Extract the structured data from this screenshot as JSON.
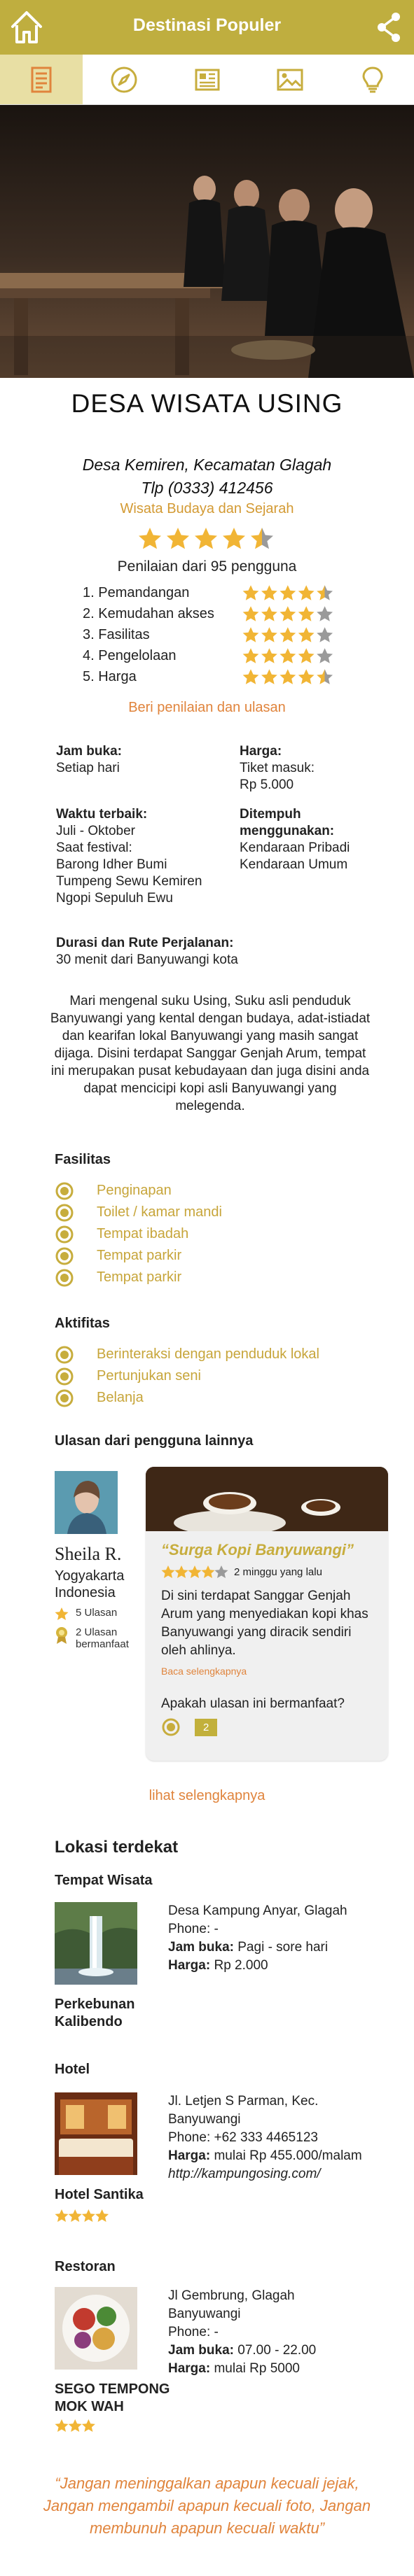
{
  "header": {
    "title": "Destinasi Populer",
    "home_icon": "home-icon",
    "share_icon": "share-icon",
    "color": "#bfae3f"
  },
  "tabs": [
    {
      "icon": "document-icon",
      "active": true
    },
    {
      "icon": "compass-icon",
      "active": false
    },
    {
      "icon": "newspaper-icon",
      "active": false
    },
    {
      "icon": "image-icon",
      "active": false
    },
    {
      "icon": "lightbulb-icon",
      "active": false
    }
  ],
  "destination": {
    "name": "DESA WISATA USING",
    "address_line1": "Desa Kemiren, Kecamatan Glagah",
    "address_line2": "Tlp (0333) 412456",
    "category": "Wisata Budaya dan Sejarah",
    "rating": 4.5,
    "rating_text": "Penilaian dari 95 pengguna",
    "criteria": [
      {
        "label": "1. Pemandangan",
        "rating": 4.5
      },
      {
        "label": "2. Kemudahan akses",
        "rating": 4
      },
      {
        "label": "3. Fasilitas",
        "rating": 4
      },
      {
        "label": "4. Pengelolaan",
        "rating": 4
      },
      {
        "label": "5. Harga",
        "rating": 4.5
      }
    ],
    "rate_link": "Beri penilaian dan ulasan"
  },
  "info": {
    "open_label": "Jam buka:",
    "open_value": "Setiap hari",
    "price_label": "Harga:",
    "price_line1": "Tiket masuk:",
    "price_line2": "Rp 5.000",
    "best_time_label": "Waktu terbaik:",
    "best_time_line1": "Juli - Oktober",
    "best_time_line2": "Saat festival:",
    "best_time_line3": "Barong Idher Bumi",
    "best_time_line4": "Tumpeng Sewu Kemiren",
    "best_time_line5": "Ngopi Sepuluh Ewu",
    "reach_label_line1": "Ditempuh",
    "reach_label_line2": "menggunakan:",
    "reach_line1": "Kendaraan Pribadi",
    "reach_line2": "Kendaraan Umum",
    "route_label": "Durasi dan Rute Perjalanan:",
    "route_value": "30 menit dari Banyuwangi kota"
  },
  "description": "Mari mengenal suku Using, Suku asli penduduk Banyuwangi yang kental dengan budaya, adat-istiadat dan kearifan lokal Banyuwangi yang masih sangat dijaga. Disini terdapat Sanggar Genjah Arum, tempat ini merupakan pusat kebudayaan dan juga disini anda dapat mencicipi kopi asli Banyuwangi yang melegenda.",
  "facilities": {
    "heading": "Fasilitas",
    "items": [
      "Penginapan",
      "Toilet / kamar mandi",
      "Tempat ibadah",
      "Tempat parkir",
      "Tempat parkir"
    ]
  },
  "activities": {
    "heading": "Aktifitas",
    "items": [
      "Berinteraksi dengan penduduk lokal",
      "Pertunjukan seni",
      "Belanja"
    ]
  },
  "reviews": {
    "heading": "Ulasan dari pengguna lainnya",
    "reviewer_name": "Sheila R.",
    "reviewer_location_line1": "Yogyakarta",
    "reviewer_location_line2": "Indonesia",
    "review_count": "5 Ulasan",
    "helpful_line1": "2 Ulasan",
    "helpful_line2": "bermanfaat",
    "review_title": "“Surga Kopi Banyuwangi”",
    "review_rating": 4,
    "review_time": "2 minggu yang lalu",
    "review_body": "Di sini terdapat Sanggar Genjah Arum yang menyediakan kopi khas Banyuwangi yang diracik sendiri oleh ahlinya.",
    "read_more": "Baca selengkapnya",
    "question": "Apakah ulasan ini bermanfaat?",
    "helpful_votes": "2",
    "see_more": "lihat selengkapnya"
  },
  "nearby": {
    "heading": "Lokasi terdekat",
    "attraction_heading": "Tempat Wisata",
    "attraction": {
      "name_line1": "Perkebunan",
      "name_line2": "Kalibendo",
      "addr": "Desa Kampung Anyar, Glagah",
      "phone": "Phone: -",
      "hours_label": "Jam buka:",
      "hours_value": " Pagi - sore hari",
      "price_label": "Harga:",
      "price_value": " Rp 2.000"
    },
    "hotel_heading": "Hotel",
    "hotel": {
      "name": "Hotel Santika",
      "stars": 4,
      "addr_line1": "Jl. Letjen S Parman, Kec.",
      "addr_line2": "Banyuwangi",
      "phone": "Phone: +62 333 4465123",
      "price_label": "Harga:",
      "price_value": " mulai Rp 455.000/malam",
      "web": "http://kampungosing.com/"
    },
    "resto_heading": "Restoran",
    "resto": {
      "name_line1": "SEGO TEMPONG",
      "name_line2": "MOK WAH",
      "stars": 3,
      "addr_line1": "Jl Gembrung, Glagah",
      "addr_line2": "Banyuwangi",
      "phone": "Phone: -",
      "hours_label": "Jam buka:",
      "hours_value": " 07.00 - 22.00",
      "price_label": "Harga:",
      "price_value": " mulai Rp 5000"
    }
  },
  "footer_quote": "“Jangan meninggalkan apapun kecuali jejak, Jangan mengambil apapun kecuali foto, Jangan membunuh apapun kecuali waktu”"
}
